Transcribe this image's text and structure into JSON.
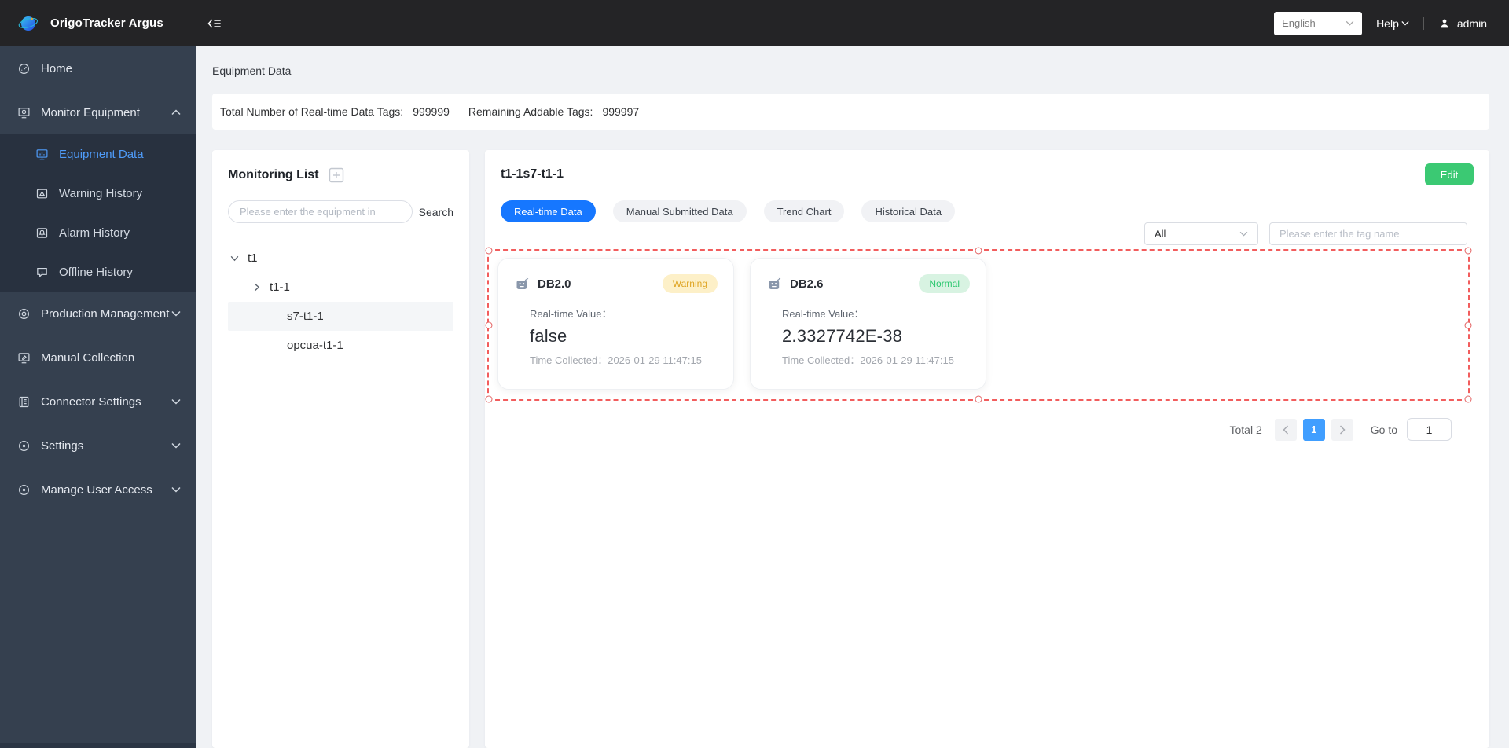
{
  "topbar": {
    "app_title": "OrigoTracker Argus",
    "language_selected": "English",
    "help_label": "Help",
    "username": "admin"
  },
  "sidebar": {
    "home": "Home",
    "monitor_equipment": "Monitor Equipment",
    "equipment_data": "Equipment Data",
    "warning_history": "Warning History",
    "alarm_history": "Alarm History",
    "offline_history": "Offline History",
    "production_management": "Production Management",
    "manual_collection": "Manual Collection",
    "connector_settings": "Connector Settings",
    "settings": "Settings",
    "manage_user_access": "Manage User Access"
  },
  "page": {
    "title": "Equipment Data",
    "stats": {
      "total_label": "Total Number of Real-time Data Tags:",
      "total_value": "999999",
      "remaining_label": "Remaining Addable Tags:",
      "remaining_value": "999997"
    }
  },
  "monitoring_list": {
    "title": "Monitoring List",
    "search_placeholder": "Please enter the equipment in",
    "search_button": "Search",
    "tree": [
      {
        "label": "t1"
      },
      {
        "label": "t1-1"
      },
      {
        "label": "s7-t1-1"
      },
      {
        "label": "opcua-t1-1"
      }
    ]
  },
  "detail": {
    "title": "t1-1s7-t1-1",
    "edit_button": "Edit",
    "tabs": [
      {
        "label": "Real-time Data",
        "active": true
      },
      {
        "label": "Manual Submitted Data",
        "active": false
      },
      {
        "label": "Trend Chart",
        "active": false
      },
      {
        "label": "Historical Data",
        "active": false
      }
    ],
    "filter": {
      "type_selected": "All",
      "tag_placeholder": "Please enter the tag name"
    },
    "cards": [
      {
        "name": "DB2.0",
        "status": "Warning",
        "value_label": "Real-time Value：",
        "value": "false",
        "time_label": "Time Collected：",
        "time": "2026-01-29 11:47:15"
      },
      {
        "name": "DB2.6",
        "status": "Normal",
        "value_label": "Real-time Value：",
        "value": "2.3327742E-38",
        "time_label": "Time Collected：",
        "time": "2026-01-29 11:47:15"
      }
    ],
    "pagination": {
      "total_label": "Total 2",
      "current_page": "1",
      "goto_label": "Go to",
      "goto_value": "1"
    }
  },
  "colors": {
    "topbar_bg": "#242426",
    "sidebar_bg": "#35404f",
    "sidebar_submenu_bg": "#28313f",
    "active_link_blue": "#4f9cfa",
    "tab_active_blue": "#1677ff",
    "edit_green": "#3bc973",
    "warning_badge_bg": "#fdf0c8",
    "warning_badge_text": "#dfa524",
    "normal_badge_bg": "#d8f3e2",
    "normal_badge_text": "#2cc76f",
    "selection_red": "#f25d5d",
    "pagination_active_blue": "#409eff",
    "content_bg": "#f0f2f5"
  }
}
